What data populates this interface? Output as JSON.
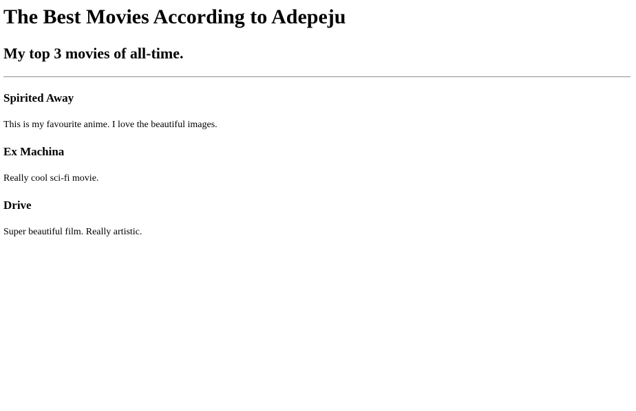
{
  "title": "The Best Movies According to Adepeju",
  "subtitle": "My top 3 movies of all-time.",
  "movies": [
    {
      "name": "Spirited Away",
      "description": "This is my favourite anime. I love the beautiful images."
    },
    {
      "name": "Ex Machina",
      "description": "Really cool sci-fi movie."
    },
    {
      "name": "Drive",
      "description": "Super beautiful film. Really artistic."
    }
  ]
}
